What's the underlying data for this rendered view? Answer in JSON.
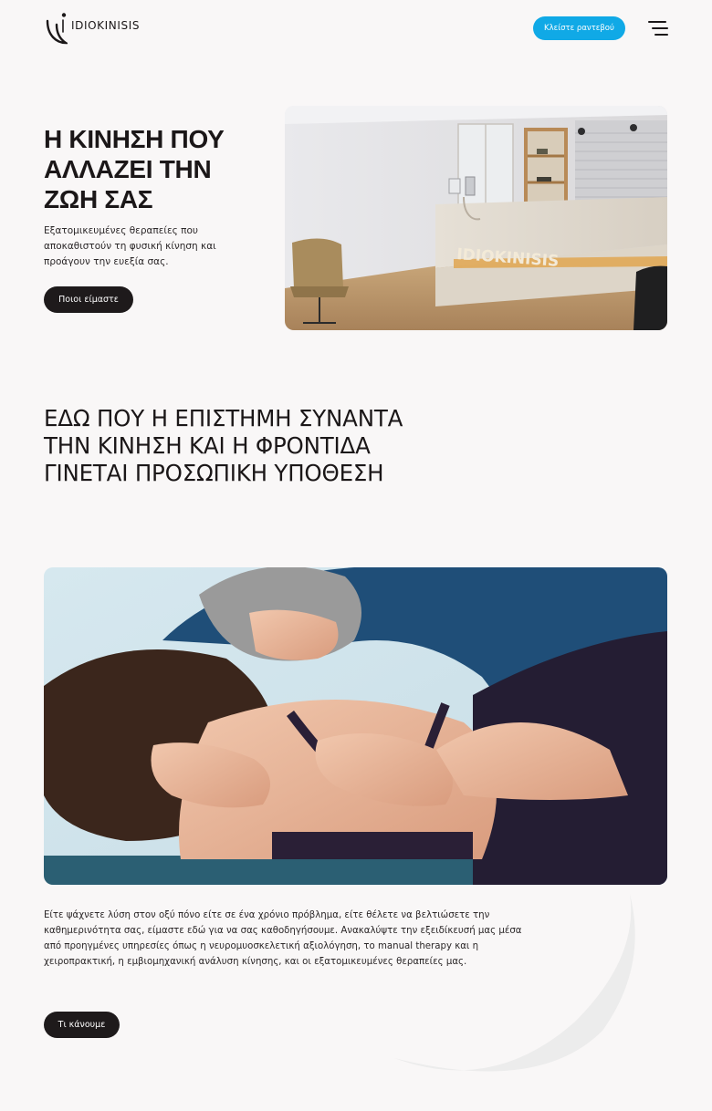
{
  "header": {
    "logo_text": "IDIOKINISIS",
    "cta_label": "Κλείστε ραντεβού",
    "menu_icon": "hamburger-menu-icon",
    "cta_color": "#10a9e6"
  },
  "hero": {
    "title": "Η ΚΙΝΗΣΗ ΠΟΥ\nΑΛΛΑΖΕΙ ΤΗΝ\nΖΩΗ ΣΑΣ",
    "text": "Εξατομικευμένες θεραπείες που αποκαθιστούν τη φυσική κίνηση και προάγουν την ευεξία σας.",
    "button_label": "Ποιοι είμαστε",
    "image_sign": "IDIOKINISIS"
  },
  "intro": {
    "title": "ΕΔΩ ΠΟΥ Η ΕΠΙΣΤΗΜΗ ΣΥΝΑΝΤΑ\nΤΗΝ ΚΙΝΗΣΗ ΚΑΙ Η ΦΡΟΝΤΙΔΑ\nΓΙΝΕΤΑΙ ΠΡΟΣΩΠΙΚΗ ΥΠΟΘΕΣΗ",
    "text": "Είτε ψάχνετε λύση στον οξύ πόνο είτε σε ένα  χρόνιο πρόβλημα, είτε θέλετε να βελτιώσετε την καθημερινότητα σας, είμαστε εδώ για να σας καθοδηγήσουμε. Ανακαλύψτε την εξειδίκευσή μας μέσα από προηγμένες υπηρεσίες όπως η νευρομυοσκελετική αξιολόγηση, το manual therapy και η χειροπρακτική, η εμβιομηχανική ανάλυση κίνησης, και οι εξατομικευμένες θεραπείες μας.",
    "button_label": "Τι κάνουμε"
  }
}
